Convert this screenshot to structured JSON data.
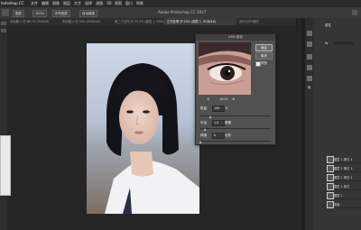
{
  "app": {
    "name": "hotoshop CC",
    "title": "Adobe Photoshop CC 2017"
  },
  "menubar": {
    "items": [
      "文件",
      "编辑",
      "图像",
      "图层",
      "文字",
      "选择",
      "滤镜",
      "3D",
      "视图",
      "窗口",
      "帮助"
    ]
  },
  "options_bar": {
    "buttons": [
      "图层",
      "100%",
      "所有图层",
      "自动增强"
    ]
  },
  "tabs": [
    {
      "label": "未标题-1 @ 66.7% (RGB/8)",
      "active": false
    },
    {
      "label": "未标题-2 @ 50% (RGB/8#)",
      "active": false
    },
    {
      "label": "第二个文件 @ 33.3% (图层 1, RGB/8)",
      "active": false
    },
    {
      "label": "正在处理 @ 25% (图层 1, RGB/8#)",
      "active": true
    },
    {
      "label": "另存为JPG格式",
      "active": false
    }
  ],
  "dialog": {
    "title": "USM 锐化",
    "ok_label": "确定",
    "cancel_label": "取消",
    "preview_label": "预览",
    "zoom_value": "100%",
    "amount_label": "数量",
    "amount_value": "100",
    "amount_unit": "%",
    "radius_label": "半径",
    "radius_value": "1.0",
    "radius_unit": "像素",
    "threshold_label": "阈值",
    "threshold_value": "0",
    "threshold_unit": "色阶"
  },
  "right_panel": {
    "layer_rows": [
      "图层 1 拷贝 4",
      "图层 1 拷贝 3",
      "图层 1 拷贝 2",
      "图层 1 拷贝",
      "图层 1",
      "背景"
    ],
    "properties_label": "属性",
    "size_label": "W"
  },
  "colors": {
    "accent": "#2d8cf0",
    "canvas_bg": "#262626",
    "dialog_bg": "#515151"
  }
}
